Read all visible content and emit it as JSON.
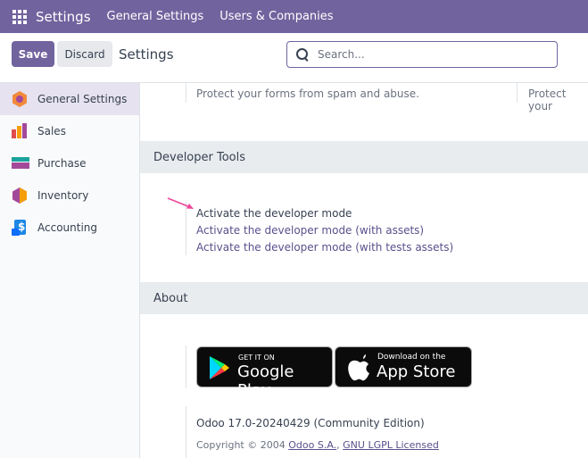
{
  "navbar": {
    "brand": "Settings",
    "links": [
      "General Settings",
      "Users & Companies"
    ]
  },
  "control_panel": {
    "save_label": "Save",
    "discard_label": "Discard",
    "title": "Settings",
    "search": {
      "placeholder": "Search..."
    }
  },
  "sidebar": {
    "items": [
      {
        "label": "General Settings",
        "icon": "general-settings-icon",
        "active": true
      },
      {
        "label": "Sales",
        "icon": "sales-icon"
      },
      {
        "label": "Purchase",
        "icon": "purchase-icon"
      },
      {
        "label": "Inventory",
        "icon": "inventory-icon"
      },
      {
        "label": "Accounting",
        "icon": "accounting-icon"
      }
    ]
  },
  "main": {
    "spam_text": "Protect your forms from spam and abuse.",
    "spam_text_right": "Protect your",
    "developer_tools": {
      "title": "Developer Tools",
      "links": [
        "Activate the developer mode",
        "Activate the developer mode (with assets)",
        "Activate the developer mode (with tests assets)"
      ]
    },
    "about": {
      "title": "About",
      "google_play": {
        "small": "GET IT ON",
        "big": "Google Play"
      },
      "app_store": {
        "small": "Download on the",
        "big": "App Store"
      },
      "version": "Odoo 17.0-20240429 (Community Edition)",
      "copyright_prefix": "Copyright © 2004",
      "company_link": "Odoo S.A.",
      "license_link": "GNU LGPL Licensed"
    }
  },
  "colors": {
    "navbar": "#71639e",
    "primary": "#71639e",
    "link": "#5b4f8c",
    "annotation_arrow": "#ec4899"
  }
}
